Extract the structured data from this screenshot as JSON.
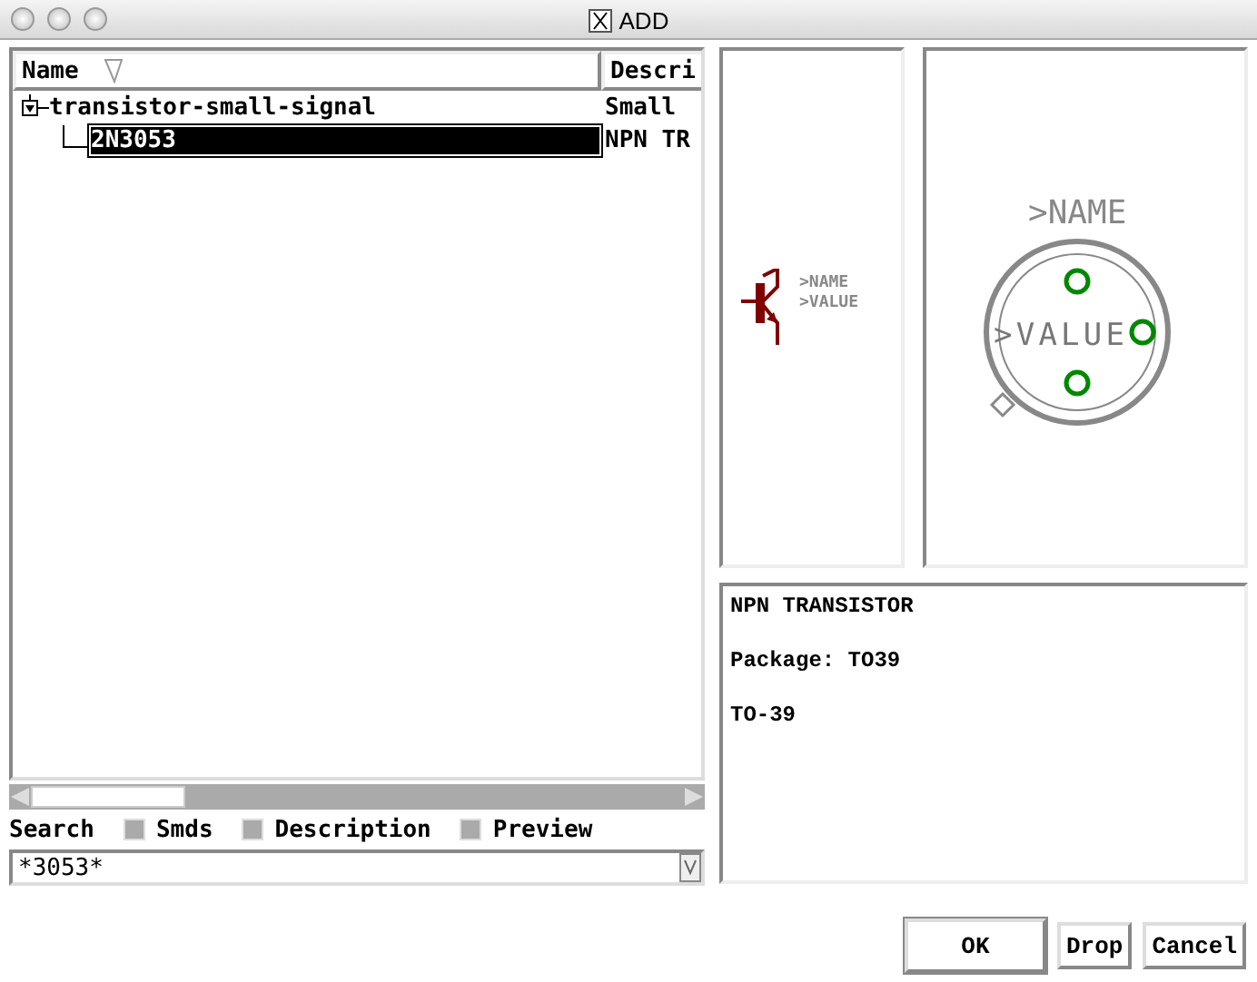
{
  "window": {
    "title": "ADD"
  },
  "table": {
    "columns": [
      {
        "label": "Name",
        "sorted": true
      },
      {
        "label": "Descri"
      }
    ],
    "rows": [
      {
        "name": "transistor-small-signal",
        "description": "Small",
        "expanded": true,
        "selected": false,
        "children": [
          {
            "name": "2N3053",
            "description": "NPN TR",
            "selected": true
          }
        ]
      }
    ]
  },
  "search": {
    "label": "Search",
    "value": "*3053*"
  },
  "options": [
    {
      "label": "Smds",
      "checked": false
    },
    {
      "label": "Description",
      "checked": false
    },
    {
      "label": "Preview",
      "checked": false
    }
  ],
  "symbol_preview": {
    "name_label": ">NAME",
    "value_label": ">VALUE"
  },
  "package_preview": {
    "name_label": ">NAME",
    "value_label": ">VALUE"
  },
  "description": [
    "NPN TRANSISTOR",
    "Package: TO39",
    "TO-39"
  ],
  "buttons": [
    {
      "label": "OK",
      "default": true
    },
    {
      "label": "Drop",
      "default": false
    },
    {
      "label": "Cancel",
      "default": false
    }
  ]
}
